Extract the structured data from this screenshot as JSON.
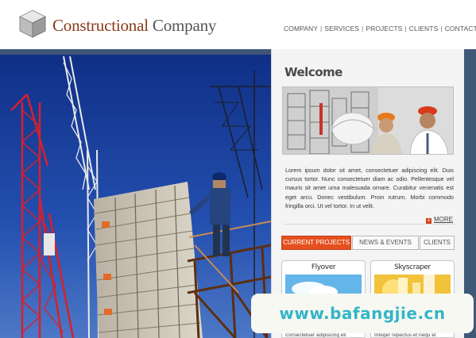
{
  "brand": {
    "name_part1": "Constructional",
    "name_part2": " Company",
    "icon": "cube-logo-icon"
  },
  "nav": {
    "items": [
      {
        "label": "COMPANY"
      },
      {
        "label": "SERVICES"
      },
      {
        "label": "PROJECTS"
      },
      {
        "label": "CLIENTS"
      },
      {
        "label": "CONTACT"
      }
    ],
    "separator": "|"
  },
  "hero": {
    "icons": [
      "crane-icon",
      "building-icon",
      "worker-icon"
    ]
  },
  "welcome": {
    "title": "Welcome",
    "text": "Lorem ipsum dolor sit amet, consectetuer adipiscing elit. Duis cursus tortor. Nunc consectetuer diam ac odio. Pellentesque vel mauris sit amet urna malesuada ornare. Curabitur venenatis est eget arcu. Donec vestibulum. Proin rutrum. Morbi commodo fringilla orci. Ut vel tortor. In ut velit.",
    "more_label": "MORE",
    "more_icon": "plus-icon"
  },
  "tabs": [
    {
      "label": "CURRENT PROJECTS",
      "active": true
    },
    {
      "label": "NEWS & EVENTS",
      "active": false
    },
    {
      "label": "CLIENTS",
      "active": false
    }
  ],
  "projects": [
    {
      "title": "Flyover",
      "text": "consectetuer adipiscing eli"
    },
    {
      "title": "Skyscraper",
      "text": "Integer repectus et nequ el"
    }
  ],
  "watermark": {
    "text": "www.bafangjie.cn"
  },
  "colors": {
    "accent": "#e5501e",
    "brand_red": "#8a3a1a",
    "frame_blue": "#3f5878",
    "sky_blue": "#1b3f9a",
    "crane_red": "#d8202a",
    "watermark_cyan": "#33b6c6"
  }
}
